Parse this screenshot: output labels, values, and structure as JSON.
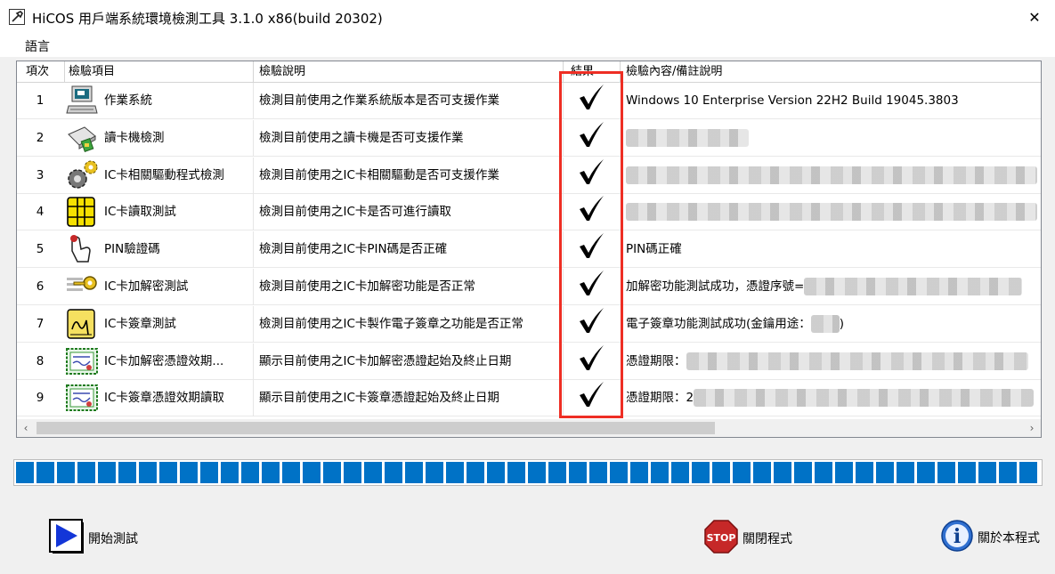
{
  "window": {
    "title": "HiCOS 用戶端系統環境檢測工具 3.1.0 x86(build 20302)",
    "close_glyph": "✕"
  },
  "menu": {
    "language": "語言"
  },
  "columns": [
    "項次",
    "檢驗項目",
    "檢驗說明",
    "結果",
    "檢驗內容/備註說明"
  ],
  "result_icon": "checkmark-icon",
  "rows": [
    {
      "num": "1",
      "icon": "computer-icon",
      "item": "作業系統",
      "desc": "檢測目前使用之作業系統版本是否可支援作業",
      "result": "✓",
      "detail": "Windows 10 Enterprise Version 22H2 Build 19045.3803"
    },
    {
      "num": "2",
      "icon": "card-reader-icon",
      "item": "讀卡機檢測",
      "desc": "檢測目前使用之讀卡機是否可支援作業",
      "result": "✓",
      "detail": ""
    },
    {
      "num": "3",
      "icon": "gears-icon",
      "item": "IC卡相關驅動程式檢測",
      "desc": "檢測目前使用之IC卡相關驅動是否可支援作業",
      "result": "✓",
      "detail": ""
    },
    {
      "num": "4",
      "icon": "chip-icon",
      "item": "IC卡讀取測試",
      "desc": "檢測目前使用之IC卡是否可進行讀取",
      "result": "✓",
      "detail": ""
    },
    {
      "num": "5",
      "icon": "hand-pin-icon",
      "item": "PIN驗證碼",
      "desc": "檢測目前使用之IC卡PIN碼是否正確",
      "result": "✓",
      "detail": "PIN碼正確"
    },
    {
      "num": "6",
      "icon": "key-icon",
      "item": "IC卡加解密測試",
      "desc": "檢測目前使用之IC卡加解密功能是否正常",
      "result": "✓",
      "detail": "加解密功能測試成功，憑證序號="
    },
    {
      "num": "7",
      "icon": "signature-icon",
      "item": "IC卡簽章測試",
      "desc": "檢測目前使用之IC卡製作電子簽章之功能是否正常",
      "result": "✓",
      "detail": "電子簽章功能測試成功(金鑰用途：",
      "detail_suffix": ")"
    },
    {
      "num": "8",
      "icon": "certificate-icon",
      "item": "IC卡加解密憑證效期...",
      "desc": "顯示目前使用之IC卡加解密憑證起始及終止日期",
      "result": "✓",
      "detail": "憑證期限："
    },
    {
      "num": "9",
      "icon": "certificate-icon",
      "item": "IC卡簽章憑證效期讀取",
      "desc": "顯示目前使用之IC卡簽章憑證起始及終止日期",
      "result": "✓",
      "detail": "憑證期限：2"
    }
  ],
  "progress": {
    "percent": 100,
    "color": "#0072c6"
  },
  "buttons": {
    "start": "開始測試",
    "stop": "關閉程式",
    "stop_icon_text": "STOP",
    "about": "關於本程式",
    "about_icon_text": "i"
  },
  "colors": {
    "highlight": "#ee2e24",
    "stop": "#c62828",
    "start": "#1336d8"
  }
}
